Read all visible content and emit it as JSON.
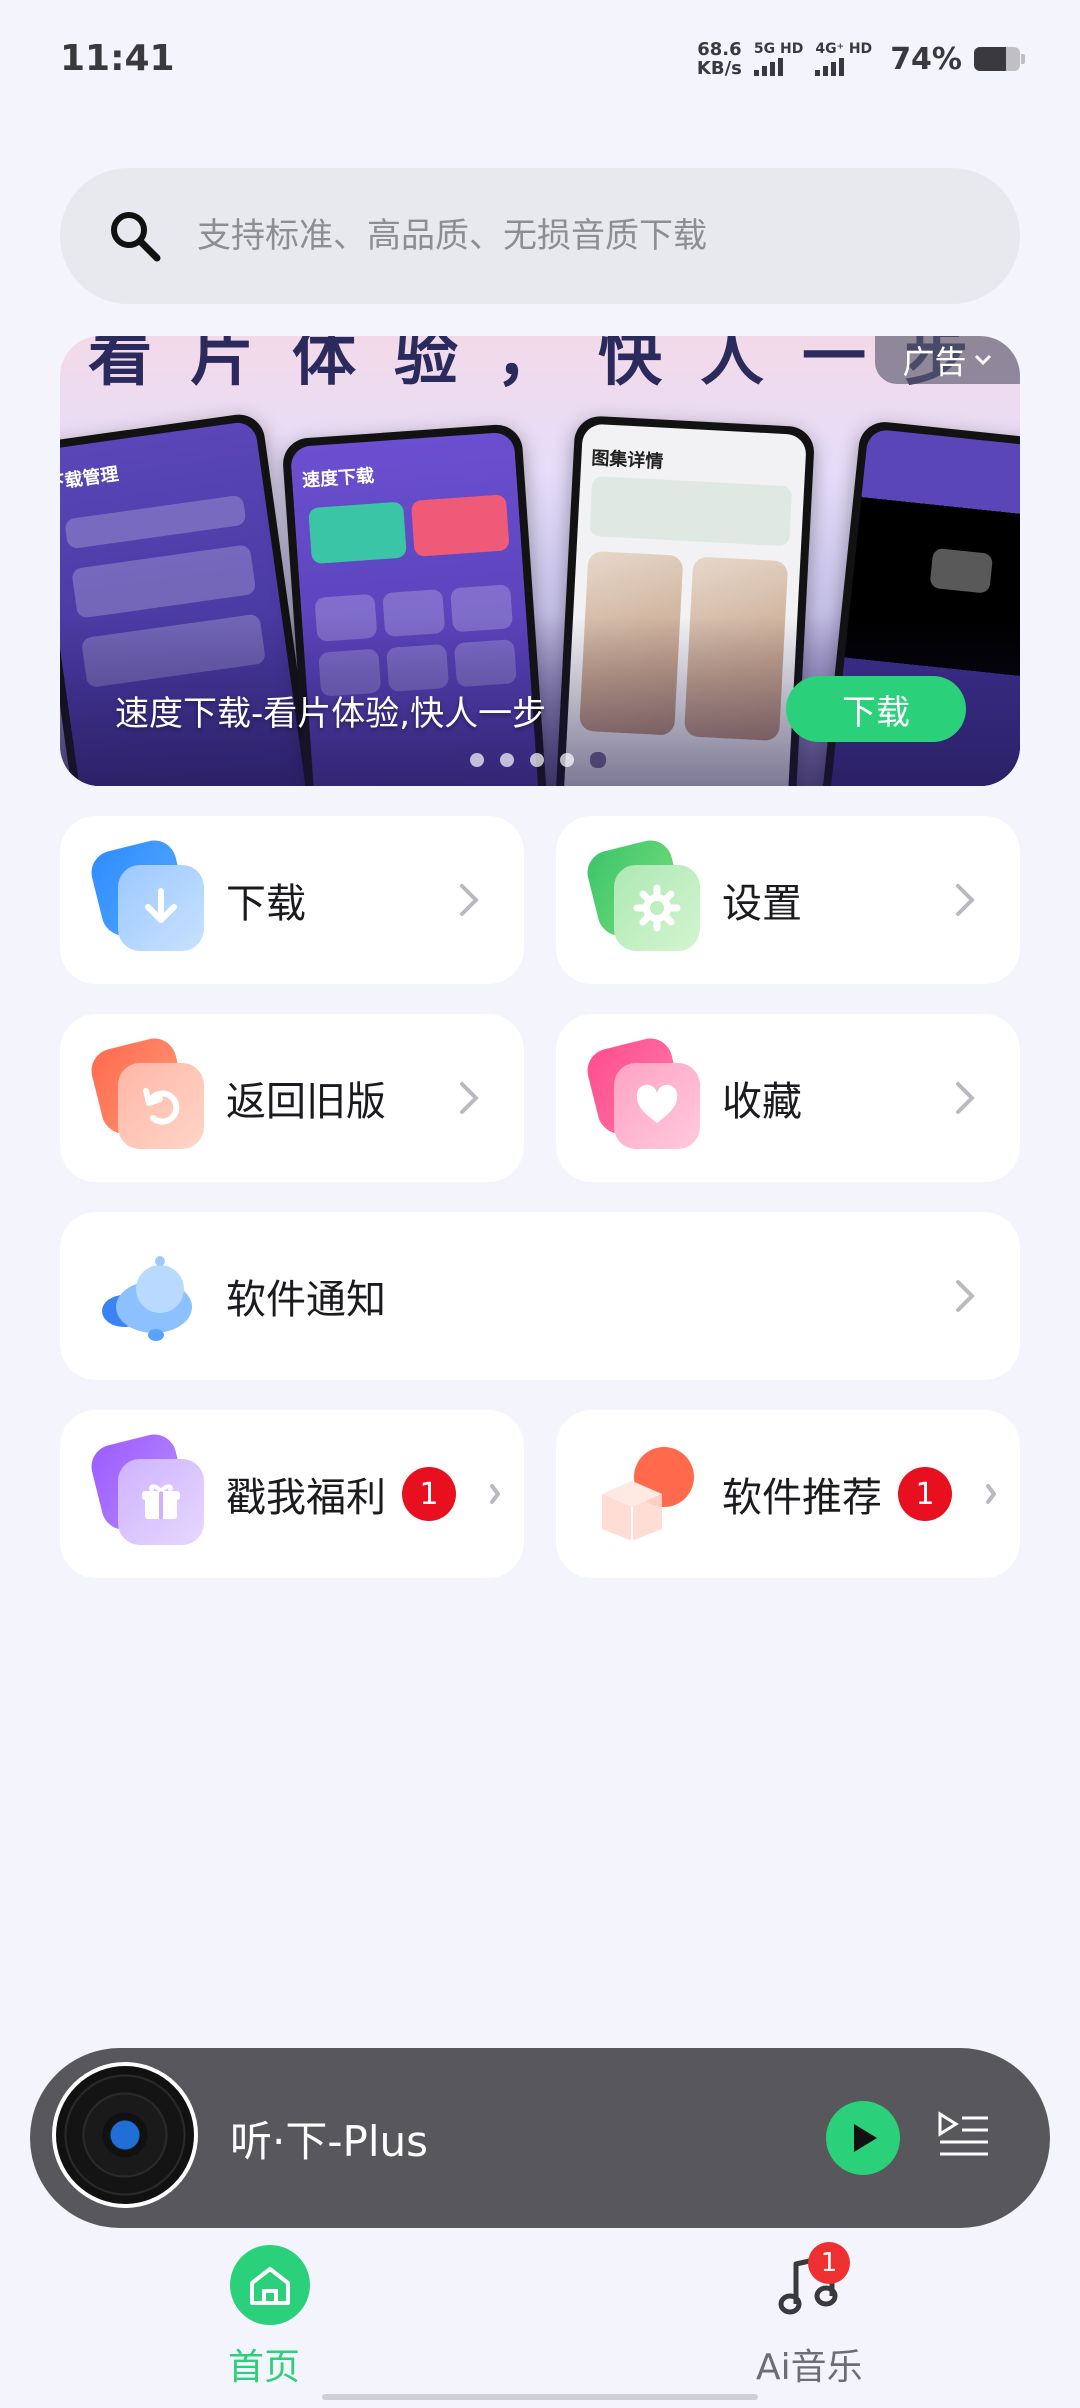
{
  "status_bar": {
    "time": "11:41",
    "net_speed_value": "68.6",
    "net_speed_unit": "KB/s",
    "sim1": "5G HD",
    "sim2": "4G⁺ HD",
    "battery": "74%"
  },
  "search": {
    "placeholder": "支持标准、高品质、无损音质下载"
  },
  "banner": {
    "top_text": "看片体验，快人一步",
    "ad_label": "广告",
    "caption": "速度下载-看片体验,快人一步",
    "download_label": "下载",
    "phone_titles": [
      "下载管理",
      "速度下载",
      "图集详情",
      ""
    ],
    "page_count": 5,
    "active_page": 5
  },
  "menu": {
    "download": "下载",
    "settings": "设置",
    "old_version": "返回旧版",
    "favorites": "收藏",
    "notifications": "软件通知",
    "welfare": "戳我福利",
    "welfare_count": "1",
    "recommend": "软件推荐",
    "recommend_count": "1"
  },
  "player": {
    "title": "听·下-Plus"
  },
  "bottom_nav": {
    "home_label": "首页",
    "music_label": "Ai音乐",
    "music_badge": "1"
  },
  "colors": {
    "accent": "#2ad17a",
    "badge": "#e8101e",
    "page_bg": "#f4f5fc"
  }
}
